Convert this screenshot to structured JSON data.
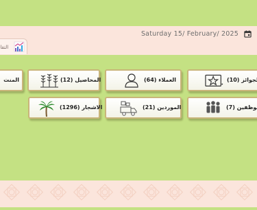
{
  "header": {
    "date": "Saturday 15/ February/ 2025",
    "calendar_icon": "calendar-icon"
  },
  "report_tab": {
    "label": "التقار",
    "icon": "chart-icon"
  },
  "tiles": {
    "awards": "الجوائز (10)",
    "clients": "العملاء (64)",
    "crops": "المحاصيل (12)",
    "products": "المنت",
    "employees": "الموظفين (7)",
    "suppliers": "الموردين (21)",
    "trees": "الاشجار (1296)"
  },
  "colors": {
    "background": "#c4e183",
    "band": "#fbe5dc",
    "tile_border": "#c9b57a"
  }
}
